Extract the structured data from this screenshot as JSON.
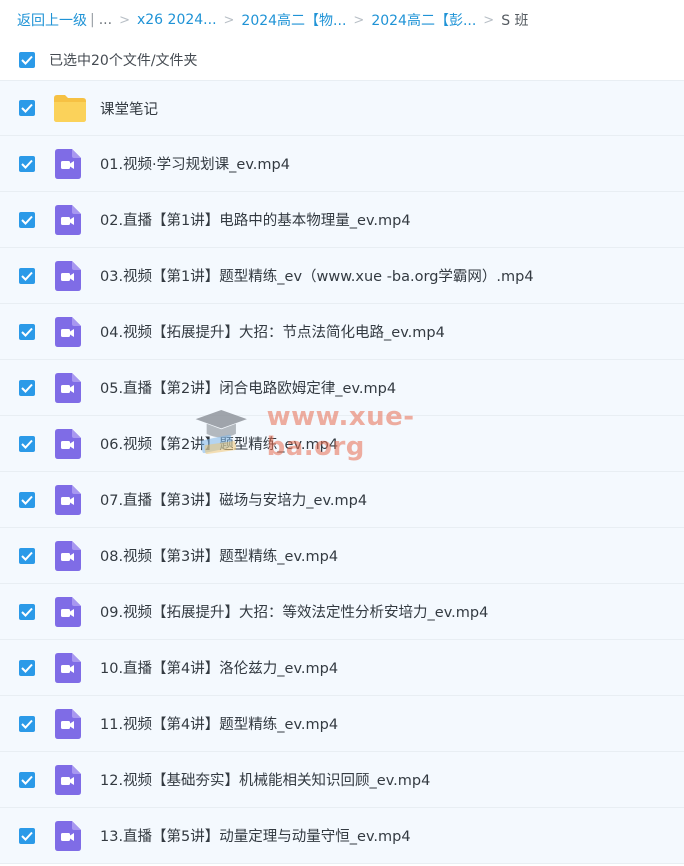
{
  "breadcrumb": {
    "back": "返回上一级",
    "more": "...",
    "items": [
      "x26 2024...",
      "2024高二【物...",
      "2024高二【彭..."
    ],
    "current": "S 班"
  },
  "selection": {
    "text": "已选中20个文件/文件夹"
  },
  "files": [
    {
      "type": "folder",
      "name": "课堂笔记"
    },
    {
      "type": "video",
      "name": "01.视频·学习规划课_ev.mp4"
    },
    {
      "type": "video",
      "name": "02.直播【第1讲】电路中的基本物理量_ev.mp4"
    },
    {
      "type": "video",
      "name": "03.视频【第1讲】题型精练_ev（www.xue -ba.org学霸网）.mp4"
    },
    {
      "type": "video",
      "name": "04.视频【拓展提升】大招：节点法简化电路_ev.mp4"
    },
    {
      "type": "video",
      "name": "05.直播【第2讲】闭合电路欧姆定律_ev.mp4"
    },
    {
      "type": "video",
      "name": "06.视频【第2讲】题型精练_ev.mp4"
    },
    {
      "type": "video",
      "name": "07.直播【第3讲】磁场与安培力_ev.mp4"
    },
    {
      "type": "video",
      "name": "08.视频【第3讲】题型精练_ev.mp4"
    },
    {
      "type": "video",
      "name": "09.视频【拓展提升】大招：等效法定性分析安培力_ev.mp4"
    },
    {
      "type": "video",
      "name": "10.直播【第4讲】洛伦兹力_ev.mp4"
    },
    {
      "type": "video",
      "name": "11.视频【第4讲】题型精练_ev.mp4"
    },
    {
      "type": "video",
      "name": "12.视频【基础夯实】机械能相关知识回顾_ev.mp4"
    },
    {
      "type": "video",
      "name": "13.直播【第5讲】动量定理与动量守恒_ev.mp4"
    }
  ],
  "watermark": {
    "text": "www.xue-ba.org"
  },
  "colors": {
    "accent": "#2b9ae8",
    "video_icon": "#7f6ce6",
    "folder": "#f8cd4a"
  }
}
